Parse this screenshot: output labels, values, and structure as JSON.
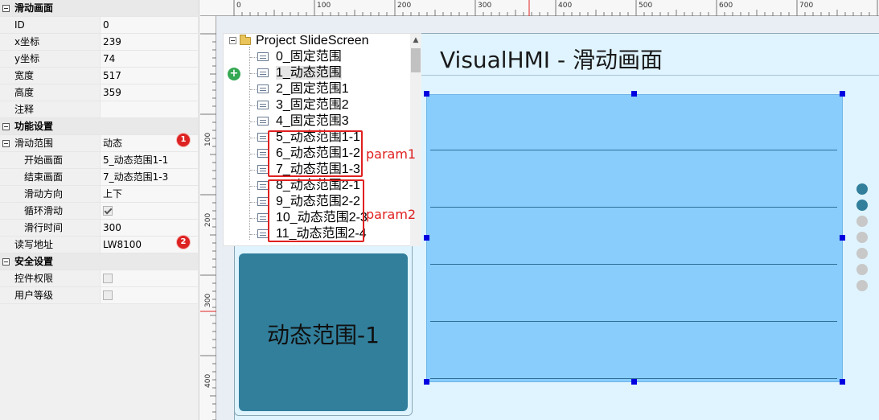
{
  "properties": {
    "sections": [
      {
        "title": "滑动画面",
        "rows": [
          {
            "name": "ID",
            "value": "0"
          },
          {
            "name": "x坐标",
            "value": "239"
          },
          {
            "name": "y坐标",
            "value": "74"
          },
          {
            "name": "宽度",
            "value": "517"
          },
          {
            "name": "高度",
            "value": "359"
          },
          {
            "name": "注释",
            "value": ""
          }
        ]
      },
      {
        "title": "功能设置",
        "rows": [
          {
            "name": "滑动范围",
            "value": "动态"
          },
          {
            "name": "开始画面",
            "value": "5_动态范围1-1"
          },
          {
            "name": "结束画面",
            "value": "7_动态范围1-3"
          },
          {
            "name": "滑动方向",
            "value": "上下"
          },
          {
            "name": "循环滑动",
            "checked": true
          },
          {
            "name": "滑行时间",
            "value": "300"
          },
          {
            "name": "读写地址",
            "value": "LW8100"
          }
        ]
      },
      {
        "title": "安全设置",
        "rows": [
          {
            "name": "控件权限",
            "checked": false
          },
          {
            "name": "用户等级",
            "checked": false
          }
        ]
      }
    ],
    "badges": [
      "1",
      "2"
    ]
  },
  "ruler": {
    "top": [
      "0",
      "100",
      "200",
      "300",
      "400",
      "500",
      "600",
      "700"
    ],
    "left": [
      "100",
      "200",
      "300",
      "400"
    ]
  },
  "tree": {
    "root": "Project SlideScreen",
    "items": [
      "0_固定范围",
      "1_动态范围",
      "2_固定范围1",
      "3_固定范围2",
      "4_固定范围3",
      "5_动态范围1-1",
      "6_动态范围1-2",
      "7_动态范围1-3",
      "8_动态范围2-1",
      "9_动态范围2-2",
      "10_动态范围2-3",
      "11_动态范围2-4"
    ],
    "selected_index": 1,
    "add_icon": "+",
    "scroll_up_icon": "▲"
  },
  "annotations": {
    "param1": "param1",
    "param2": "param2"
  },
  "canvas": {
    "title": "VisualHMI - 滑动画面",
    "slide_box_label": "动态范围-1",
    "page_dots": {
      "total": 7,
      "active": 2
    }
  },
  "colors": {
    "accent": "#327f9c",
    "slide_area": "#88cdfc",
    "screen_bg": "#dff4ff",
    "annotation": "#e02020",
    "handle": "#0000e0"
  }
}
